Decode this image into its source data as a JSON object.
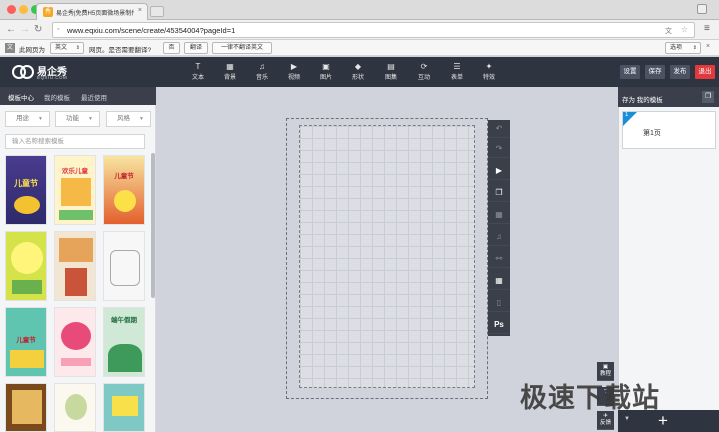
{
  "browser": {
    "tab_title": "易企秀|免费H5页面微场景制作",
    "favicon_text": "秀",
    "url": "www.eqxiu.com/scene/create/45354004?pageId=1"
  },
  "translate_bar": {
    "label": "此网页为",
    "language": "英文",
    "question": "网页。是否需要翻译?",
    "no_button": "否",
    "translate_button": "翻译",
    "never_button": "一律不翻译英文",
    "options_button": "选项"
  },
  "app": {
    "logo_text": "易企秀",
    "logo_sub": "EQXIU.COM",
    "tools": [
      {
        "label": "文本",
        "icon": "text-icon"
      },
      {
        "label": "背景",
        "icon": "background-icon"
      },
      {
        "label": "音乐",
        "icon": "music-icon"
      },
      {
        "label": "视频",
        "icon": "video-icon"
      },
      {
        "label": "图片",
        "icon": "image-icon"
      },
      {
        "label": "形状",
        "icon": "shape-icon"
      },
      {
        "label": "图集",
        "icon": "gallery-icon"
      },
      {
        "label": "互动",
        "icon": "interaction-icon"
      },
      {
        "label": "表单",
        "icon": "form-icon"
      },
      {
        "label": "特效",
        "icon": "effect-icon"
      }
    ],
    "actions": {
      "settings": "设置",
      "save": "保存",
      "publish": "发布",
      "exit": "退出"
    }
  },
  "left_panel": {
    "tabs": [
      "模板中心",
      "我的模板",
      "最近使用"
    ],
    "filters": [
      "用途",
      "功能",
      "风格"
    ],
    "search_placeholder": "输入名称搜索模板",
    "thumb_titles": [
      "儿童节",
      "欢乐儿童",
      "儿童节",
      "",
      "",
      "",
      "儿童节",
      "",
      "端午假期",
      "",
      "",
      ""
    ]
  },
  "right_panel": {
    "save_as_template": "存为 我的模板",
    "page_number": "1",
    "page_label": "第1页"
  },
  "side_tools": {
    "ps_label": "Ps"
  },
  "bottom_right": {
    "tutorial_label": "教程",
    "feedback_label": "反馈",
    "add_symbol": "+"
  },
  "watermark": "极速下载站"
}
